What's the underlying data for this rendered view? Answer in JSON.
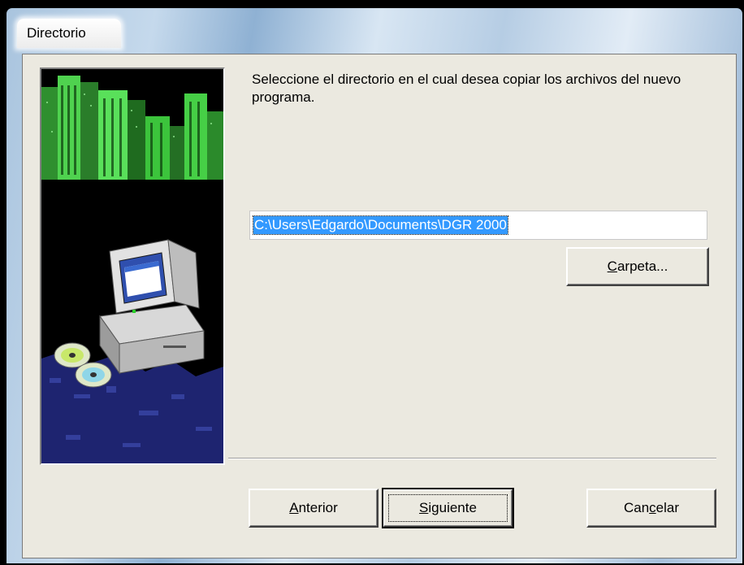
{
  "window": {
    "title": "Directorio"
  },
  "panel": {
    "instruction": "Seleccione el directorio en el cual desea copiar los archivos del nuevo programa.",
    "path_value": "C:\\Users\\Edgardo\\Documents\\DGR 2000"
  },
  "buttons": {
    "browse": {
      "accel": "C",
      "rest": "arpeta..."
    },
    "back": {
      "accel": "A",
      "rest": "nterior"
    },
    "next": {
      "accel": "S",
      "rest": "iguiente"
    },
    "cancel": {
      "pre": "Can",
      "accel": "c",
      "rest": "elar"
    }
  },
  "colors": {
    "selection": "#3399ff",
    "dialog_face": "#ebe9e0",
    "city_green": "#3cc43c"
  }
}
